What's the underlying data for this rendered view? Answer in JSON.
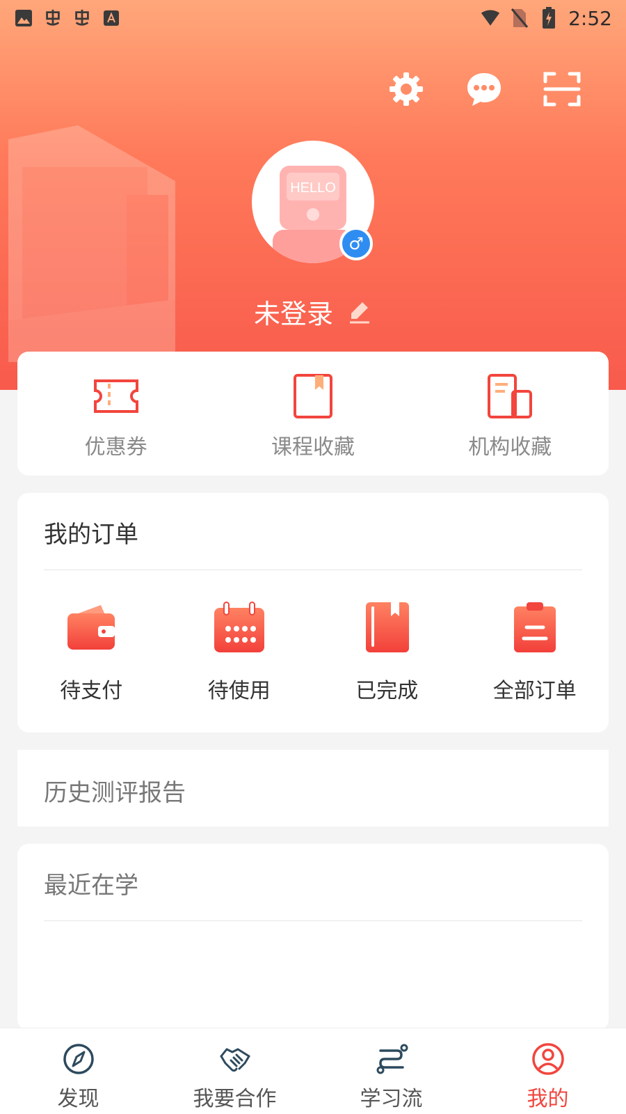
{
  "status_bar": {
    "time": "2:52"
  },
  "header": {
    "username": "未登录",
    "gender_symbol": "♂",
    "avatar_text": "HELLO"
  },
  "quick_links": [
    {
      "label": "优惠券",
      "icon": "coupon-icon"
    },
    {
      "label": "课程收藏",
      "icon": "course-bookmark-icon"
    },
    {
      "label": "机构收藏",
      "icon": "institution-icon"
    }
  ],
  "orders": {
    "title": "我的订单",
    "items": [
      {
        "label": "待支付",
        "icon": "wallet-icon"
      },
      {
        "label": "待使用",
        "icon": "calendar-icon"
      },
      {
        "label": "已完成",
        "icon": "book-icon"
      },
      {
        "label": "全部订单",
        "icon": "clipboard-icon"
      }
    ]
  },
  "history": {
    "title": "历史测评报告"
  },
  "recent": {
    "title": "最近在学"
  },
  "bottom_nav": [
    {
      "label": "发现",
      "icon": "compass-icon",
      "active": false
    },
    {
      "label": "我要合作",
      "icon": "handshake-icon",
      "active": false
    },
    {
      "label": "学习流",
      "icon": "route-icon",
      "active": false
    },
    {
      "label": "我的",
      "icon": "profile-icon",
      "active": true
    }
  ],
  "colors": {
    "accent": "#f2453d",
    "header_top": "#ffa77a",
    "header_bottom": "#f85a4c",
    "nav_icon": "#2d4a5e",
    "gender_badge": "#2f8df2"
  }
}
